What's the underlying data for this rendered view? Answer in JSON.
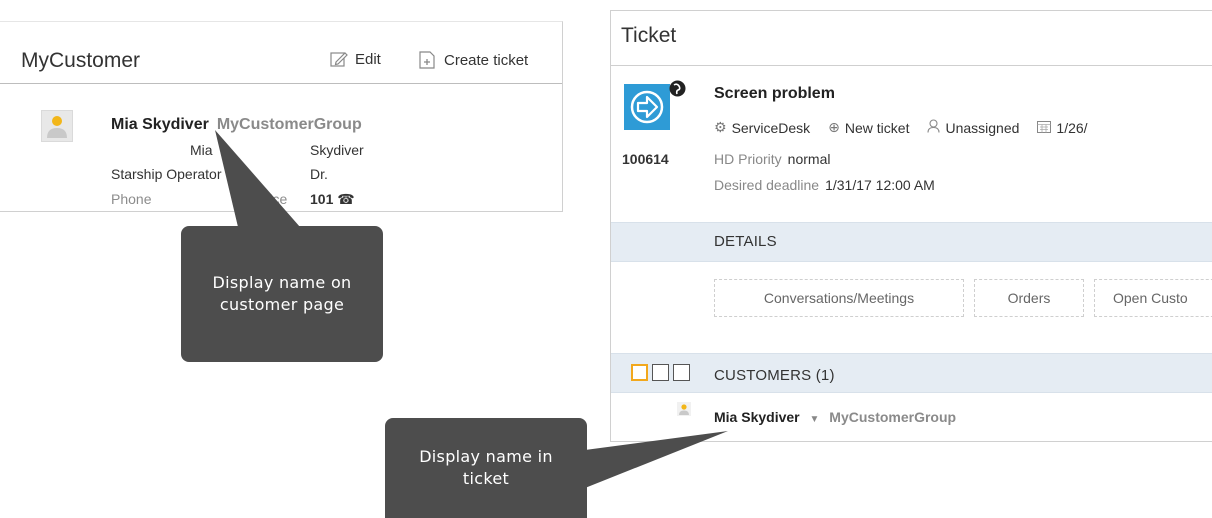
{
  "customer_panel": {
    "title": "MyCustomer",
    "edit_label": "Edit",
    "create_ticket_label": "Create ticket",
    "display_name": "Mia Skydiver",
    "group": "MyCustomerGroup",
    "first_name": "Mia",
    "last_name": "Skydiver",
    "job_title": "Starship Operator",
    "salutation": "Dr.",
    "phone_label": "Phone",
    "office_label": "Office",
    "office_value": "101 ☎"
  },
  "callouts": {
    "customer_page_text": "Display name on customer page",
    "ticket_text": "Display name in ticket"
  },
  "ticket_panel": {
    "title": "Ticket",
    "ticket_number": "100614",
    "subject": "Screen problem",
    "desk": "ServiceDesk",
    "status": "New ticket",
    "assignee": "Unassigned",
    "date": "1/26/",
    "priority_label": "HD Priority",
    "priority_value": "normal",
    "deadline_label": "Desired deadline",
    "deadline_value": "1/31/17 12:00 AM",
    "details_label": "DETAILS",
    "tabs": [
      "Conversations/Meetings",
      "Orders",
      "Open Custo"
    ],
    "customers_label": "CUSTOMERS (1)",
    "customer_name": "Mia Skydiver",
    "customer_group": "MyCustomerGroup"
  },
  "colors": {
    "ticket_icon_bg": "#2e9bd6",
    "section_bg": "#e5ecf3",
    "callout_bg": "#4d4d4d",
    "avatar_accent": "#f2b619"
  }
}
